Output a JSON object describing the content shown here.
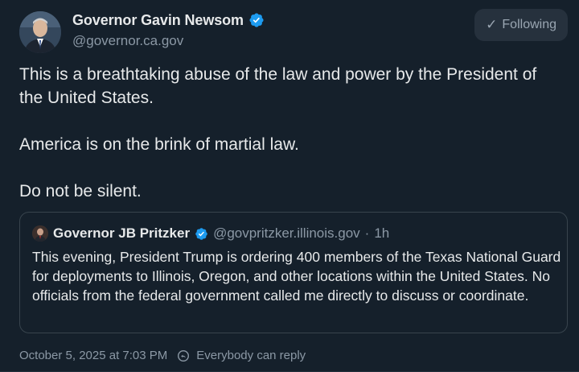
{
  "author": {
    "display_name": "Governor Gavin Newsom",
    "handle": "@governor.ca.gov",
    "verified": true,
    "verified_color": "#1d9bf0"
  },
  "follow_button": {
    "label": "Following",
    "icon": "check-icon"
  },
  "post": {
    "paragraphs": [
      "This is a breathtaking abuse of the law and power by the President of the United States.",
      "America is on the brink of martial law.",
      "Do not be silent."
    ]
  },
  "quote": {
    "display_name": "Governor JB Pritzker",
    "handle": "@govpritzker.illinois.gov",
    "separator": "·",
    "time": "1h",
    "verified": true,
    "text": "This evening, President Trump is ordering 400 members of the Texas National Guard for deployments to Illinois, Oregon, and other locations within the United States. No officials from the federal government called me directly to discuss or coordinate."
  },
  "meta": {
    "timestamp": "October 5, 2025 at 7:03 PM",
    "reply_setting": "Everybody can reply",
    "reply_icon": "reply-setting-icon"
  },
  "colors": {
    "background": "#15202b",
    "text_primary": "#e7e9ea",
    "text_secondary": "#8b98a5",
    "border": "#38444d",
    "accent": "#1d9bf0"
  }
}
